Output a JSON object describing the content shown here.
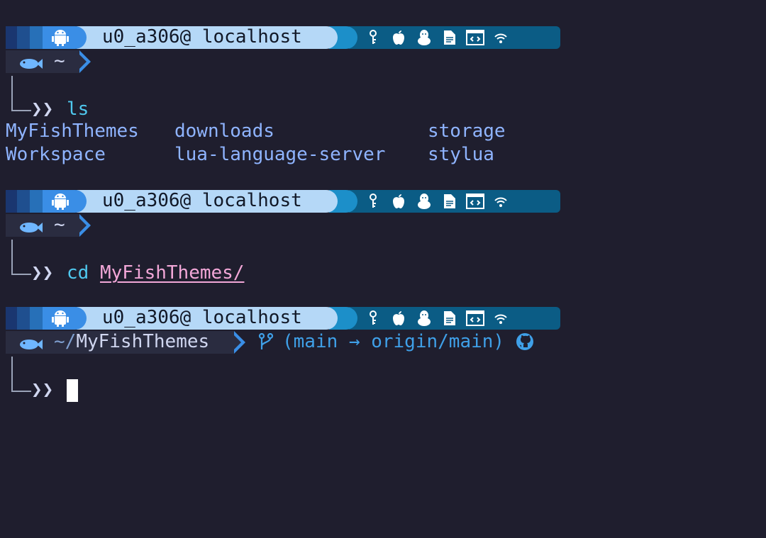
{
  "prompt": {
    "user_host": "u0_a306@ localhost",
    "chevrons": "❯❯",
    "home": "~",
    "path_prefix": "~/",
    "path_dir": "MyFishThemes",
    "git_status": "(main → origin/main)"
  },
  "status_icons": [
    "key-icon",
    "apple-icon",
    "linux-penguin-icon",
    "file-icon",
    "code-window-icon",
    "wifi-icon"
  ],
  "commands": [
    {
      "cmd": "ls",
      "arg": ""
    },
    {
      "cmd": "cd",
      "arg": "MyFishThemes/"
    }
  ],
  "ls_output": [
    [
      "MyFishThemes",
      "downloads",
      "storage"
    ],
    [
      "Workspace",
      "lua-language-server",
      "stylua"
    ]
  ],
  "colors": {
    "background": "#1f1e2e",
    "accent_blue": "#3a8ee6",
    "user_segment": "#b5d8f7",
    "status_segment": "#0b5c85",
    "command": "#4fc8ee",
    "path_arg": "#f2a7d8",
    "ls_text": "#8fb4ff"
  }
}
